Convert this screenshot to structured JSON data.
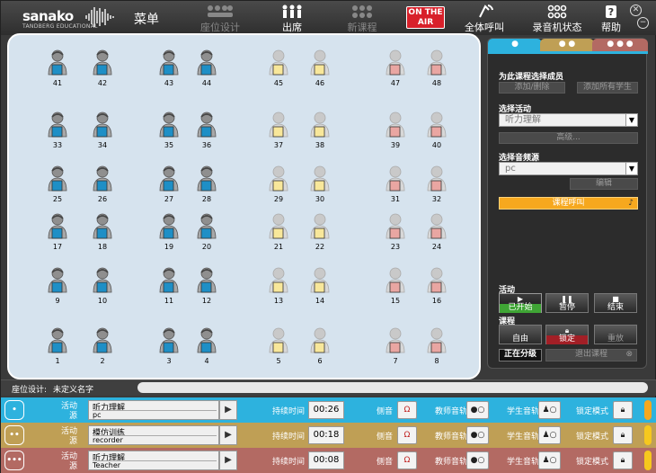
{
  "header": {
    "brand": "sanako",
    "brand_sub": "TANDBERG EDUCATIONAL",
    "menu": "菜单",
    "nav": [
      {
        "label": "座位设计",
        "dim": true,
        "icon": "seating-design-icon"
      },
      {
        "label": "出席",
        "dim": false,
        "icon": "attendance-icon"
      },
      {
        "label": "新课程",
        "dim": true,
        "icon": "new-course-icon"
      },
      {
        "label": "全体呼叫",
        "dim": false,
        "icon": "call-all-icon"
      },
      {
        "label": "录音机状态",
        "dim": false,
        "icon": "recorder-status-icon"
      },
      {
        "label": "帮助",
        "dim": false,
        "icon": "help-icon"
      }
    ],
    "on_air": "ON THE AIR",
    "close_symbol": "✕",
    "min_symbol": "−"
  },
  "colors": {
    "blue_seat": "#1e8fc6",
    "yellow_seat": "#f8e79a",
    "pink_seat": "#e9a6a2",
    "orange": "#f6a81e",
    "row1": "#2db2de",
    "row2": "#bf9f55",
    "row3": "#b36a63"
  },
  "seats": [
    {
      "n": "41",
      "c": "blue",
      "dark": true
    },
    {
      "n": "42",
      "c": "blue",
      "dark": true
    },
    {
      "n": "43",
      "c": "blue",
      "dark": true
    },
    {
      "n": "44",
      "c": "blue",
      "dark": true
    },
    {
      "n": "45",
      "c": "yellow",
      "dark": false
    },
    {
      "n": "46",
      "c": "yellow",
      "dark": false
    },
    {
      "n": "47",
      "c": "pink",
      "dark": false
    },
    {
      "n": "48",
      "c": "pink",
      "dark": false
    },
    {
      "n": "33",
      "c": "blue",
      "dark": true
    },
    {
      "n": "34",
      "c": "blue",
      "dark": true
    },
    {
      "n": "35",
      "c": "blue",
      "dark": true
    },
    {
      "n": "36",
      "c": "blue",
      "dark": true
    },
    {
      "n": "37",
      "c": "yellow",
      "dark": false
    },
    {
      "n": "38",
      "c": "yellow",
      "dark": false
    },
    {
      "n": "39",
      "c": "pink",
      "dark": false
    },
    {
      "n": "40",
      "c": "pink",
      "dark": false
    },
    {
      "n": "25",
      "c": "blue",
      "dark": true
    },
    {
      "n": "26",
      "c": "blue",
      "dark": true
    },
    {
      "n": "27",
      "c": "blue",
      "dark": true
    },
    {
      "n": "28",
      "c": "blue",
      "dark": true
    },
    {
      "n": "29",
      "c": "yellow",
      "dark": false
    },
    {
      "n": "30",
      "c": "yellow",
      "dark": false
    },
    {
      "n": "31",
      "c": "pink",
      "dark": false
    },
    {
      "n": "32",
      "c": "pink",
      "dark": false
    },
    {
      "n": "17",
      "c": "blue",
      "dark": true
    },
    {
      "n": "18",
      "c": "blue",
      "dark": true
    },
    {
      "n": "19",
      "c": "blue",
      "dark": true
    },
    {
      "n": "20",
      "c": "blue",
      "dark": true
    },
    {
      "n": "21",
      "c": "yellow",
      "dark": false
    },
    {
      "n": "22",
      "c": "yellow",
      "dark": false
    },
    {
      "n": "23",
      "c": "pink",
      "dark": false
    },
    {
      "n": "24",
      "c": "pink",
      "dark": false
    },
    {
      "n": "9",
      "c": "blue",
      "dark": true
    },
    {
      "n": "10",
      "c": "blue",
      "dark": true
    },
    {
      "n": "11",
      "c": "blue",
      "dark": true
    },
    {
      "n": "12",
      "c": "blue",
      "dark": true
    },
    {
      "n": "13",
      "c": "yellow",
      "dark": false
    },
    {
      "n": "14",
      "c": "yellow",
      "dark": false
    },
    {
      "n": "15",
      "c": "pink",
      "dark": false
    },
    {
      "n": "16",
      "c": "pink",
      "dark": false
    },
    {
      "n": "1",
      "c": "blue",
      "dark": true
    },
    {
      "n": "2",
      "c": "blue",
      "dark": true
    },
    {
      "n": "3",
      "c": "blue",
      "dark": true
    },
    {
      "n": "4",
      "c": "blue",
      "dark": true
    },
    {
      "n": "5",
      "c": "yellow",
      "dark": false
    },
    {
      "n": "6",
      "c": "yellow",
      "dark": false
    },
    {
      "n": "7",
      "c": "pink",
      "dark": false
    },
    {
      "n": "8",
      "c": "pink",
      "dark": false
    }
  ],
  "status": {
    "label": "座位设计:",
    "value": "未定义名字"
  },
  "side": {
    "select_members": "为此课程选择成员",
    "add_remove": "添加/删除",
    "add_all": "添加所有学生",
    "select_activity": "选择活动",
    "activity_value": "听力理解",
    "advanced": "高级...",
    "select_source": "选择音频源",
    "source_value": "pc",
    "edit": "编辑",
    "course_call": "课程呼叫",
    "activity_title": "活动",
    "started": "已开始",
    "pause": "暂停",
    "stop": "结束",
    "course_title": "课程",
    "free": "自由",
    "lock": "锁定",
    "reset": "重放",
    "grouping": "正在分级",
    "exit_course": "退出课程"
  },
  "rows": [
    {
      "ctl": "•",
      "activity_lbl": "活动",
      "source_lbl": "源",
      "activity": "听力理解",
      "source": "pc",
      "duration_lbl": "持续时间",
      "duration": "00:26",
      "side_lbl": "侧音",
      "teacher_lbl": "教师音轨",
      "student_lbl": "学生音轨",
      "lock_lbl": "锁定模式",
      "edge": "#f6a81e"
    },
    {
      "ctl": "••",
      "activity_lbl": "活动",
      "source_lbl": "源",
      "activity": "模仿训练",
      "source": "recorder",
      "duration_lbl": "持续时间",
      "duration": "00:18",
      "side_lbl": "侧音",
      "teacher_lbl": "教师音轨",
      "student_lbl": "学生音轨",
      "lock_lbl": "锁定模式",
      "edge": "#f6c81e"
    },
    {
      "ctl": "•••",
      "activity_lbl": "活动",
      "source_lbl": "源",
      "activity": "听力理解",
      "source": "Teacher",
      "duration_lbl": "持续时间",
      "duration": "00:08",
      "side_lbl": "侧音",
      "teacher_lbl": "教师音轨",
      "student_lbl": "学生音轨",
      "lock_lbl": "锁定模式",
      "edge": "#f6c81e"
    }
  ]
}
